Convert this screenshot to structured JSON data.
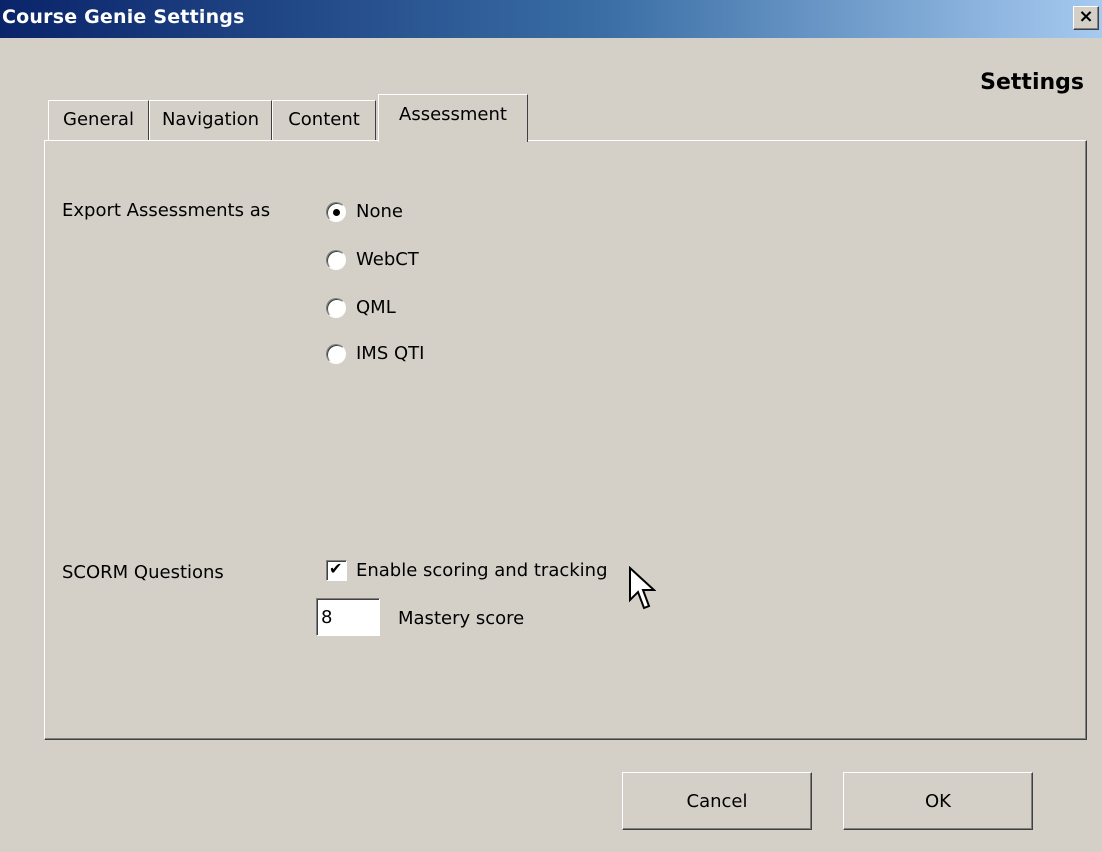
{
  "window": {
    "title": "Course Genie Settings",
    "close_glyph": "×",
    "heading": "Settings"
  },
  "tabs": [
    {
      "label": "General",
      "active": false
    },
    {
      "label": "Navigation",
      "active": false
    },
    {
      "label": "Content",
      "active": false
    },
    {
      "label": "Assessment",
      "active": true
    }
  ],
  "export": {
    "label": "Export Assessments as",
    "selected": "None",
    "options": [
      "None",
      "WebCT",
      "QML",
      "IMS QTI"
    ]
  },
  "scorm": {
    "label": "SCORM Questions",
    "enable_label": "Enable scoring and tracking",
    "enable_checked": true,
    "checkmark_glyph": "✔",
    "mastery_value": "8",
    "mastery_label": "Mastery score"
  },
  "buttons": {
    "cancel": "Cancel",
    "ok": "OK"
  },
  "icons": {
    "close": "close-icon",
    "cursor": "mouse-pointer-icon",
    "check": "checkmark-icon"
  }
}
